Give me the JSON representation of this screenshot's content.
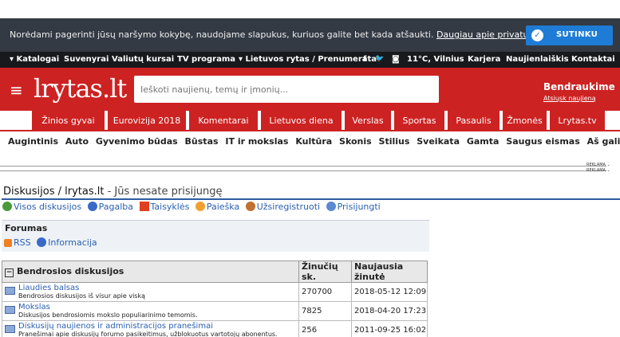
{
  "cookie": {
    "message": "Norėdami pagerinti jūsų naršymo kokybę, naudojame slapukus, kuriuos galite bet kada atšaukti.",
    "link": "Daugiau apie privatumo politika",
    "button": "SUTINKU"
  },
  "topbar": {
    "items": [
      "▾ Katalogai",
      "Suvenyrai",
      "Valiutų kursai",
      "TV programa",
      "▾ Lietuvos rytas / Prenumerata",
      "f",
      "🐦",
      "◙",
      "11°C, Vilnius",
      "Karjera",
      "Naujienlaiškis",
      "Kontaktai"
    ]
  },
  "header": {
    "logo": "lrytas.lt",
    "search_placeholder": "Ieškoti naujienų, temų ir įmonių...",
    "co_title": "Bendraukime",
    "co_sub": "Atsiųsk naujieną"
  },
  "nav": {
    "items": [
      "Žinios gyvai",
      "Eurovizija 2018",
      "Komentarai",
      "Lietuvos diena",
      "Verslas",
      "Sportas",
      "Pasaulis",
      "Žmonės",
      "Lrytas.tv"
    ]
  },
  "subnav": {
    "items": [
      "Augintinis",
      "Auto",
      "Gyvenimo būdas",
      "Būstas",
      "IT ir mokslas",
      "Kultūra",
      "Skonis",
      "Stilius",
      "Sveikata",
      "Gamta",
      "Saugus eismas",
      "Aš galiu"
    ]
  },
  "reklama": "REKLAMA ⌄",
  "page": {
    "title": "Diskusijos / lrytas.lt",
    "status": " - Jūs nesate prisijungę",
    "links": [
      "Visos diskusijos",
      "Pagalba",
      "Taisyklės",
      "Paieška",
      "Užsiregistruoti",
      "Prisijungti"
    ]
  },
  "forums": {
    "heading": "Forumas",
    "links": [
      "RSS",
      "Informacija"
    ],
    "headers": [
      "Bendrosios diskusijos",
      "Žinučių sk.",
      "Naujausia žinutė"
    ],
    "rows": [
      {
        "title": "Liaudies balsas",
        "desc": "Bendrosios diskusijos iš visur apie viską",
        "count": "270700",
        "latest": "2018-05-12 12:09"
      },
      {
        "title": "Mokslas",
        "desc": "Diskusijos bendrosiomis mokslo populiarinimo temomis.",
        "count": "7825",
        "latest": "2018-04-20 17:23"
      },
      {
        "title": "Diskusijų naujienos ir administracijos pranešimai",
        "desc": "Pranešimai apie diskusijų forumo pasikeitimus, užblokuotus vartotojų abonentus.",
        "count": "256",
        "latest": "2011-09-25 16:02"
      }
    ]
  },
  "colors": {
    "brand_red": "#cd2222",
    "link_blue": "#2a60b0",
    "cookie_bg": "#333a44"
  }
}
